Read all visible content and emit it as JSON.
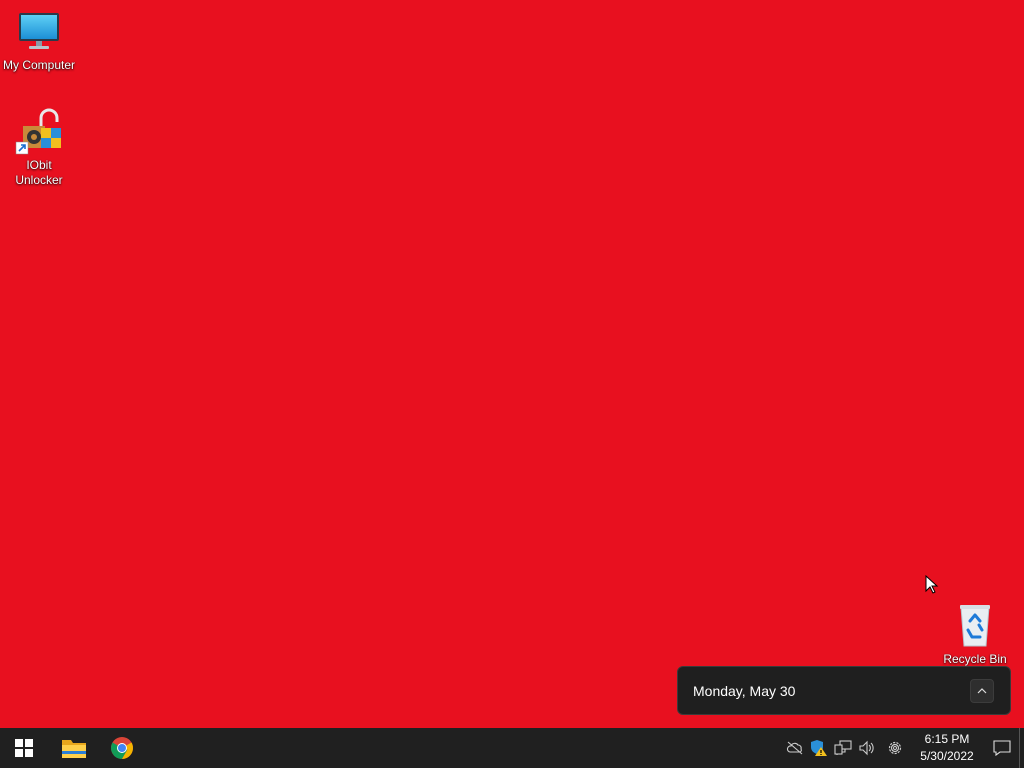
{
  "desktop": {
    "background_color": "#e8101f",
    "icons": [
      {
        "label": "My Computer",
        "icon": "monitor-icon"
      },
      {
        "label": "IObit Unlocker",
        "icon": "iobit-unlocker-icon"
      },
      {
        "label": "Recycle Bin",
        "icon": "recycle-bin-icon"
      }
    ]
  },
  "calendar_flyout": {
    "date": "Monday, May 30",
    "expand_icon": "chevron-up-icon"
  },
  "taskbar": {
    "pinned": [
      {
        "name": "start",
        "icon": "windows-icon"
      },
      {
        "name": "file-explorer",
        "icon": "folder-icon"
      },
      {
        "name": "chrome",
        "icon": "chrome-icon"
      }
    ],
    "tray_icons": [
      "onedrive-offline-icon",
      "security-warning-icon",
      "network-icon",
      "volume-icon",
      "settings-icon"
    ],
    "clock": {
      "time": "6:15 PM",
      "date": "5/30/2022"
    },
    "notification_icon": "notification-icon"
  }
}
